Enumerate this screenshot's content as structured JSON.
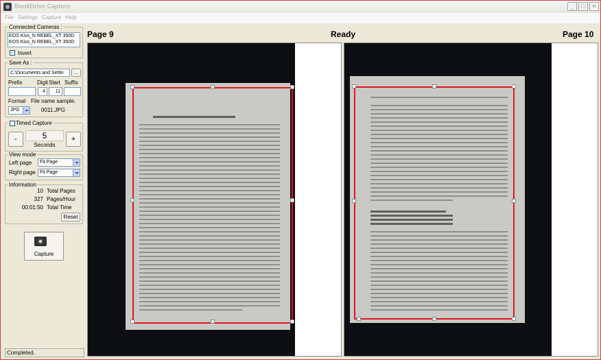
{
  "app": {
    "title": "BookDrive Capture",
    "menu": [
      "File",
      "Settings",
      "Capture",
      "Help"
    ],
    "window_buttons": {
      "minimize": "_",
      "maximize": "□",
      "close": "✕"
    }
  },
  "cameras": {
    "legend": "Connected Cameras :",
    "list": [
      "EOS Kiss_N REBEL_XT 350D",
      "EOS Kiss_N REBEL_XT 350D"
    ],
    "invert_label": "Invert",
    "invert_checked": true
  },
  "save": {
    "legend": "Save As :",
    "path": "C:\\Documents and Settin",
    "browse_label": "...",
    "prefix_label": "Prefix",
    "digit_label": "Digit",
    "start_label": "Start",
    "suffix_label": "Suffix",
    "prefix_value": "",
    "digit_value": "4",
    "start_value": "11",
    "suffix_value": "",
    "format_label": "Format",
    "sample_label": "File name sample.",
    "format_value": "JPG",
    "sample_value": "0011.JPG"
  },
  "timed": {
    "legend": "Timed Capture",
    "minus_label": "-",
    "plus_label": "+",
    "value": "5",
    "unit": "Seconds"
  },
  "view": {
    "legend": "View mode",
    "left_label": "Left page",
    "right_label": "Right page",
    "left_value": "Fit Page",
    "right_value": "Fit Page"
  },
  "info": {
    "legend": "Information",
    "total_pages_value": "10",
    "total_pages_label": "Total Pages",
    "pages_hour_value": "327",
    "pages_hour_label": "Pages/Hour",
    "total_time_value": "00:01:50",
    "total_time_label": "Total Time",
    "reset_label": "Reset"
  },
  "capture": {
    "label": "Capture",
    "icon": "camera-icon"
  },
  "status": "Completed.",
  "viewer": {
    "left_page": "Page 9",
    "center": "Ready",
    "right_page": "Page 10"
  },
  "colors": {
    "crop": "#e0161e",
    "background": "#ece9d8"
  }
}
